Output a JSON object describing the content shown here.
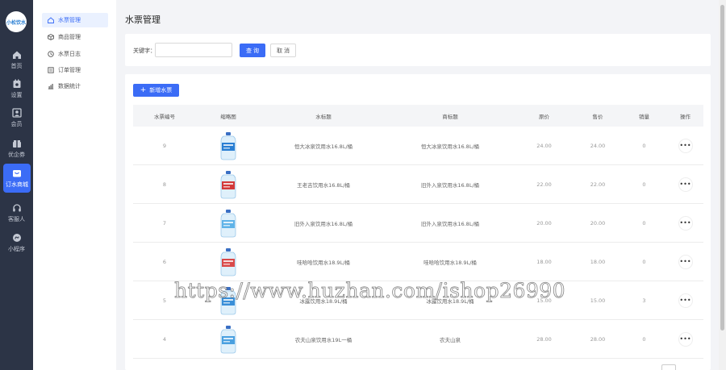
{
  "logo_text": "小松饮水",
  "rail": {
    "items": [
      {
        "label": "首页",
        "icon": "home-icon"
      },
      {
        "label": "设置",
        "icon": "settings-icon"
      },
      {
        "label": "会员",
        "icon": "member-icon"
      },
      {
        "label": "优企券",
        "icon": "coupon-icon"
      },
      {
        "label": "订水商城",
        "icon": "mall-icon"
      },
      {
        "label": "客服人",
        "icon": "headset-icon"
      },
      {
        "label": "小程序",
        "icon": "miniapp-icon"
      }
    ]
  },
  "submenu": {
    "items": [
      {
        "label": "水票管理",
        "icon": "home-icon"
      },
      {
        "label": "商品管理",
        "icon": "box-icon"
      },
      {
        "label": "水票日志",
        "icon": "clock-icon"
      },
      {
        "label": "订单管理",
        "icon": "list-icon"
      },
      {
        "label": "数据统计",
        "icon": "chart-icon"
      }
    ]
  },
  "page_title": "水票管理",
  "search": {
    "label": "关键字：",
    "value": "",
    "placeholder": "",
    "query_label": "查 询",
    "cancel_label": "取 消"
  },
  "add_button_label": "新增水票",
  "table": {
    "headers": [
      "水票编号",
      "缩略图",
      "水标题",
      "商标题",
      "原价",
      "售价",
      "销量",
      "操作"
    ],
    "rows": [
      {
        "id": "9",
        "title": "恒大冰泉饮用水16.8L/桶",
        "subtitle": "恒大冰泉饮用水16.8L/桶",
        "price": "24.00",
        "sale": "24.00",
        "sales": "0"
      },
      {
        "id": "8",
        "title": "王老吉饮用水16.8L/桶",
        "subtitle": "旧外入泉饮用水16.8L/桶",
        "price": "22.00",
        "sale": "22.00",
        "sales": "0"
      },
      {
        "id": "7",
        "title": "旧外入泉饮用水16.8L/桶",
        "subtitle": "旧外入泉饮用水16.8L/桶",
        "price": "20.00",
        "sale": "20.00",
        "sales": "0"
      },
      {
        "id": "6",
        "title": "哇哈哈饮用水18.9L/桶",
        "subtitle": "哇哈哈饮用水18.9L/桶",
        "price": "18.00",
        "sale": "18.00",
        "sales": "0"
      },
      {
        "id": "5",
        "title": "冰露饮用水18.9L/桶",
        "subtitle": "冰露饮用水18.9L/桶",
        "price": "15.00",
        "sale": "15.00",
        "sales": "3"
      },
      {
        "id": "4",
        "title": "农夫山泉饮用水19L一桶",
        "subtitle": "农夫山泉",
        "price": "28.00",
        "sale": "28.00",
        "sales": "0"
      }
    ]
  },
  "watermark": "https://www.huzhan.com/ishop26990",
  "colors": {
    "primary": "#3b6cf6",
    "rail_bg": "#2c3446",
    "page_bg": "#f3f4f7"
  }
}
